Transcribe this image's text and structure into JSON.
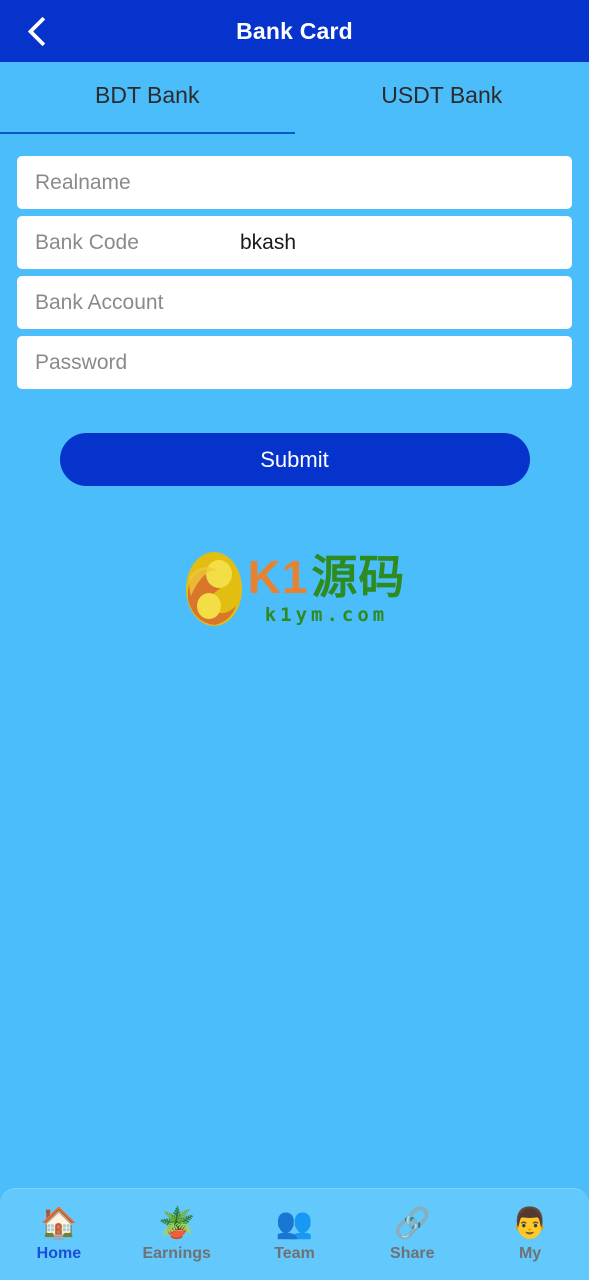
{
  "header": {
    "title": "Bank Card",
    "back_icon": "chevron-left-icon",
    "bg_color": "#0633CB",
    "title_color": "#FFFFFF"
  },
  "page": {
    "bg_color": "#4BBDFB"
  },
  "tabs": [
    {
      "label": "BDT Bank",
      "active": true
    },
    {
      "label": "USDT Bank",
      "active": false
    }
  ],
  "form": {
    "fields": [
      {
        "name": "realname",
        "placeholder": "Realname",
        "value": "",
        "type": "text"
      },
      {
        "name": "bank_code",
        "label": "Bank Code",
        "value": "bkash",
        "type": "select"
      },
      {
        "name": "bank_account",
        "placeholder": "Bank Account",
        "value": "",
        "type": "text"
      },
      {
        "name": "password",
        "placeholder": "Password",
        "value": "",
        "type": "password"
      }
    ],
    "submit_label": "Submit",
    "submit_color": "#0633CB"
  },
  "watermark": {
    "brand": "K1",
    "brand_cn": "源码",
    "domain": "k1ym.com",
    "brand_color": "#E98230",
    "cn_color": "#2E8B1F",
    "emblem_colors": {
      "shell": "#E8C41A",
      "highlight": "#F7E25C",
      "swirl": "#D9762B"
    }
  },
  "bottom_nav": {
    "items": [
      {
        "label": "Home",
        "icon": "house-icon",
        "glyph": "🏠",
        "active": true
      },
      {
        "label": "Earnings",
        "icon": "money-plant-icon",
        "glyph": "🪴",
        "active": false
      },
      {
        "label": "Team",
        "icon": "people-group-icon",
        "glyph": "👥",
        "active": false
      },
      {
        "label": "Share",
        "icon": "share-network-icon",
        "glyph": "🔗",
        "active": false
      },
      {
        "label": "My",
        "icon": "user-avatar-icon",
        "glyph": "👨",
        "active": false
      }
    ],
    "active_color": "#1B4FD8",
    "inactive_color": "#6F7275",
    "bg_color": "#63C8FC"
  }
}
